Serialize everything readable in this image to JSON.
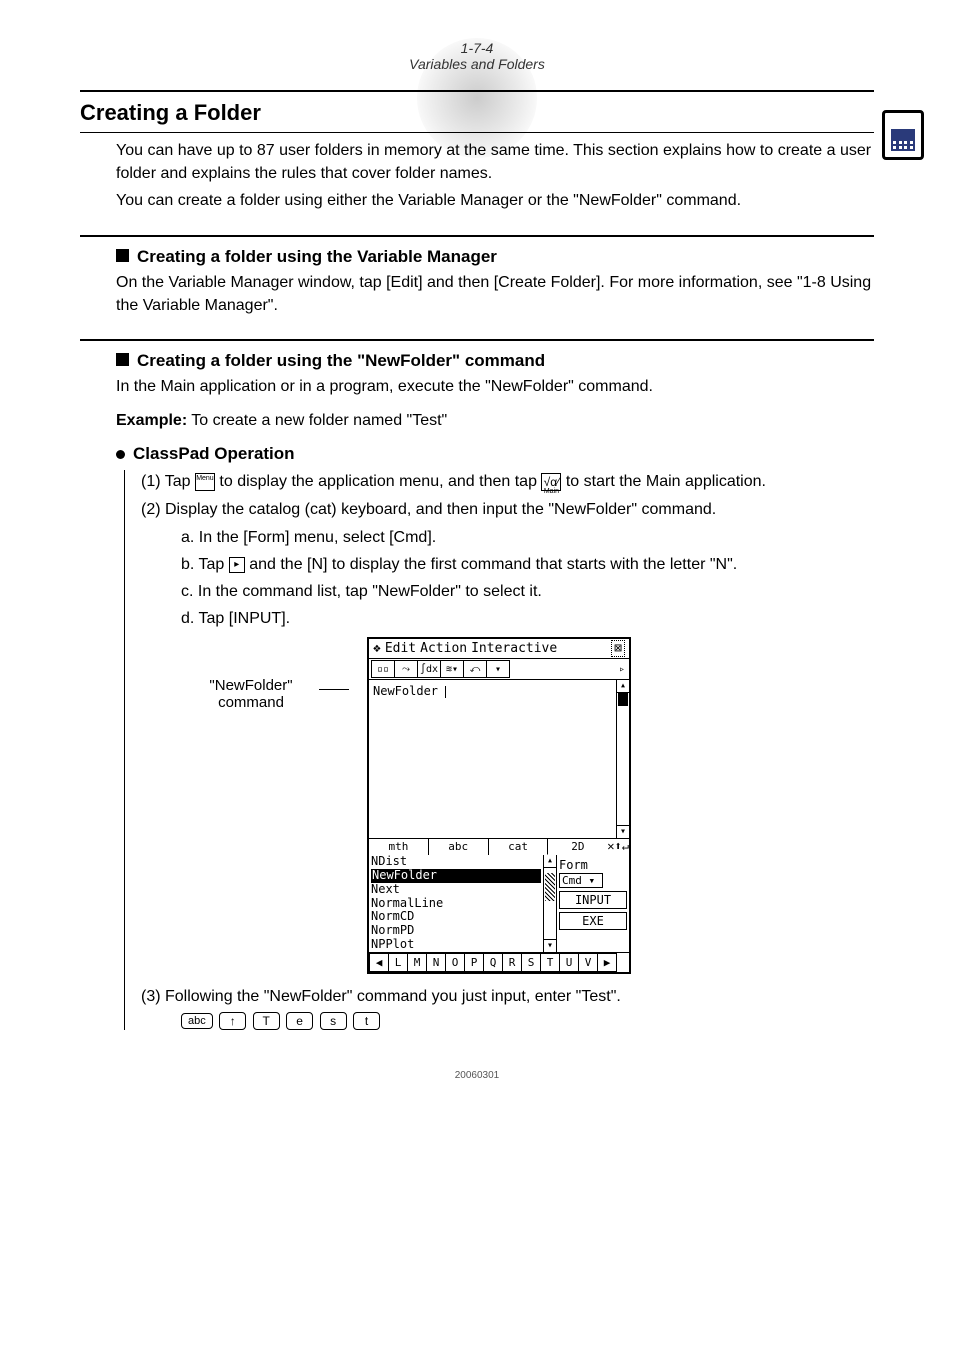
{
  "header": {
    "page_ref": "1-7-4",
    "chapter": "Variables and Folders"
  },
  "title": "Creating a Folder",
  "intro1": "You can have up to 87 user folders in memory at the same time. This section explains how to create a user folder and explains the rules that cover folder names.",
  "intro2": "You can create a folder using either the Variable Manager or the \"NewFolder\" command.",
  "sec1": {
    "heading": "Creating a folder using the Variable Manager",
    "body": "On the Variable Manager window, tap [Edit] and then [Create Folder]. For more information, see \"1-8 Using the Variable Manager\"."
  },
  "sec2": {
    "heading": "Creating a folder using the \"NewFolder\" command",
    "body": "In the Main application or in a program, execute the \"NewFolder\" command."
  },
  "example": {
    "label": "Example:",
    "text": " To create a new folder named \"Test\""
  },
  "op_heading": "ClassPad Operation",
  "steps": {
    "s1a": "(1) Tap ",
    "s1_icon1": "Menu",
    "s1b": " to display the application menu, and then tap ",
    "s1_icon2_top": "√α⁄",
    "s1_icon2_sub": "Main",
    "s1c": " to start the Main application.",
    "s2": "(2) Display the catalog (cat) keyboard, and then input the \"NewFolder\" command.",
    "s2a": "a. In the [Form] menu, select [Cmd].",
    "s2b_pre": "b. Tap ",
    "s2b_icon": "▸",
    "s2b_post": " and the [N] to display the first command that starts with the letter \"N\".",
    "s2c": "c. In the command list, tap \"NewFolder\" to select it.",
    "s2d": "d. Tap [INPUT]."
  },
  "callout": {
    "line1": "\"NewFolder\"",
    "line2": "command"
  },
  "device": {
    "menubar": {
      "icon": "❖",
      "m1": "Edit",
      "m2": "Action",
      "m3": "Interactive",
      "close": "⊠"
    },
    "workarea_text": "NewFolder ",
    "tabs": {
      "t1": "mth",
      "t2": "abc",
      "t3": "cat",
      "t4": "2D",
      "x": "✕",
      "up": "⬆",
      "dn": "↵"
    },
    "catlist": [
      "NDist",
      "NewFolder",
      "Next",
      "NormalLine",
      "NormCD",
      "NormPD",
      "NPPlot"
    ],
    "side": {
      "form_label": "Form",
      "form_sel": "Cmd",
      "sel_arrow": "▾",
      "btn_input": "INPUT",
      "btn_exe": "EXE"
    },
    "letters": [
      "◀",
      "L",
      "M",
      "N",
      "O",
      "P",
      "Q",
      "R",
      "S",
      "T",
      "U",
      "V",
      "▶"
    ]
  },
  "step3": "(3) Following the \"NewFolder\" command you just input, enter \"Test\".",
  "keycaps": [
    "abc",
    "↑",
    "T",
    "e",
    "s",
    "t"
  ],
  "footer": "20060301"
}
